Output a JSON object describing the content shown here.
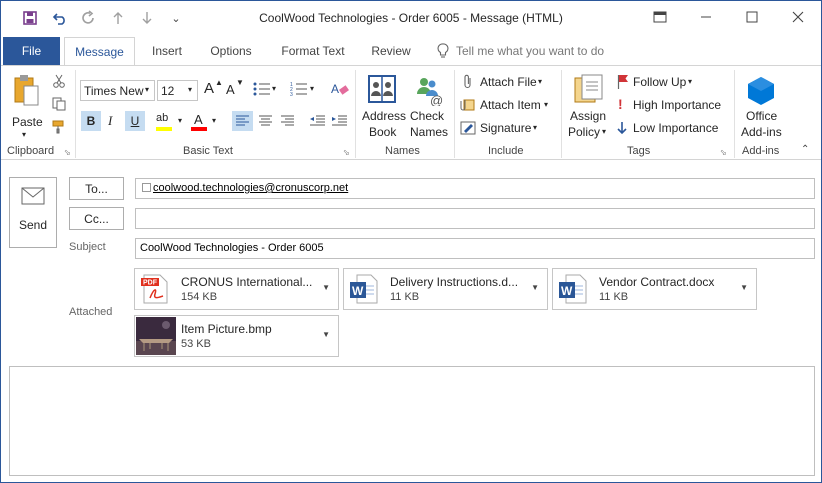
{
  "window": {
    "title": "CoolWood Technologies - Order 6005  -  Message (HTML)"
  },
  "quick_access": {
    "qa_more": "⌄"
  },
  "tabs": [
    {
      "label": "File"
    },
    {
      "label": "Message"
    },
    {
      "label": "Insert"
    },
    {
      "label": "Options"
    },
    {
      "label": "Format Text"
    },
    {
      "label": "Review"
    }
  ],
  "tell_me": {
    "placeholder": "Tell me what you want to do"
  },
  "ribbon": {
    "clipboard": {
      "label": "Clipboard",
      "paste": "Paste"
    },
    "basic_text": {
      "label": "Basic Text",
      "font": "Times New",
      "size": "12",
      "grow": "A",
      "shrink": "A",
      "bold": "B",
      "italic": "I",
      "underline": "U",
      "highlight": "ab",
      "fontcolor": "A"
    },
    "names": {
      "label": "Names",
      "address_book_1": "Address",
      "address_book_2": "Book",
      "check_names_1": "Check",
      "check_names_2": "Names"
    },
    "include": {
      "label": "Include",
      "attach_file": "Attach File",
      "attach_item": "Attach Item",
      "signature": "Signature"
    },
    "tags": {
      "label": "Tags",
      "assign_policy_1": "Assign",
      "assign_policy_2": "Policy",
      "follow_up": "Follow Up",
      "high_importance": "High Importance",
      "low_importance": "Low Importance"
    },
    "addins": {
      "label": "Add-ins",
      "office_addins_1": "Office",
      "office_addins_2": "Add-ins"
    }
  },
  "compose": {
    "send": "Send",
    "to_button": "To...",
    "cc_button": "Cc...",
    "subject_label": "Subject",
    "attached_label": "Attached",
    "to_value": "coolwood.technologies@cronuscorp.net",
    "cc_value": "",
    "subject_value": "CoolWood Technologies - Order 6005"
  },
  "attachments": [
    {
      "name": "CRONUS International...",
      "size": "154 KB",
      "type": "pdf"
    },
    {
      "name": "Delivery Instructions.d...",
      "size": "11 KB",
      "type": "word"
    },
    {
      "name": "Vendor Contract.docx",
      "size": "11 KB",
      "type": "word"
    },
    {
      "name": "Item Picture.bmp",
      "size": "53 KB",
      "type": "image"
    }
  ],
  "colors": {
    "accent": "#2b579a",
    "word_blue": "#2b5797",
    "pdf_red": "#e0301e",
    "highlight_yellow": "#ffff00",
    "font_red": "#ff0000",
    "follow_up_red": "#d13438",
    "addins_blue": "#0078d7"
  },
  "icons": {
    "save": "save-icon",
    "undo": "undo-icon",
    "redo": "redo-icon",
    "up": "arrow-up-icon",
    "down": "arrow-down-icon",
    "restore": "restore-icon",
    "minimize": "minimize-icon",
    "maximize": "maximize-icon",
    "close": "close-icon",
    "lightbulb": "lightbulb-icon"
  }
}
